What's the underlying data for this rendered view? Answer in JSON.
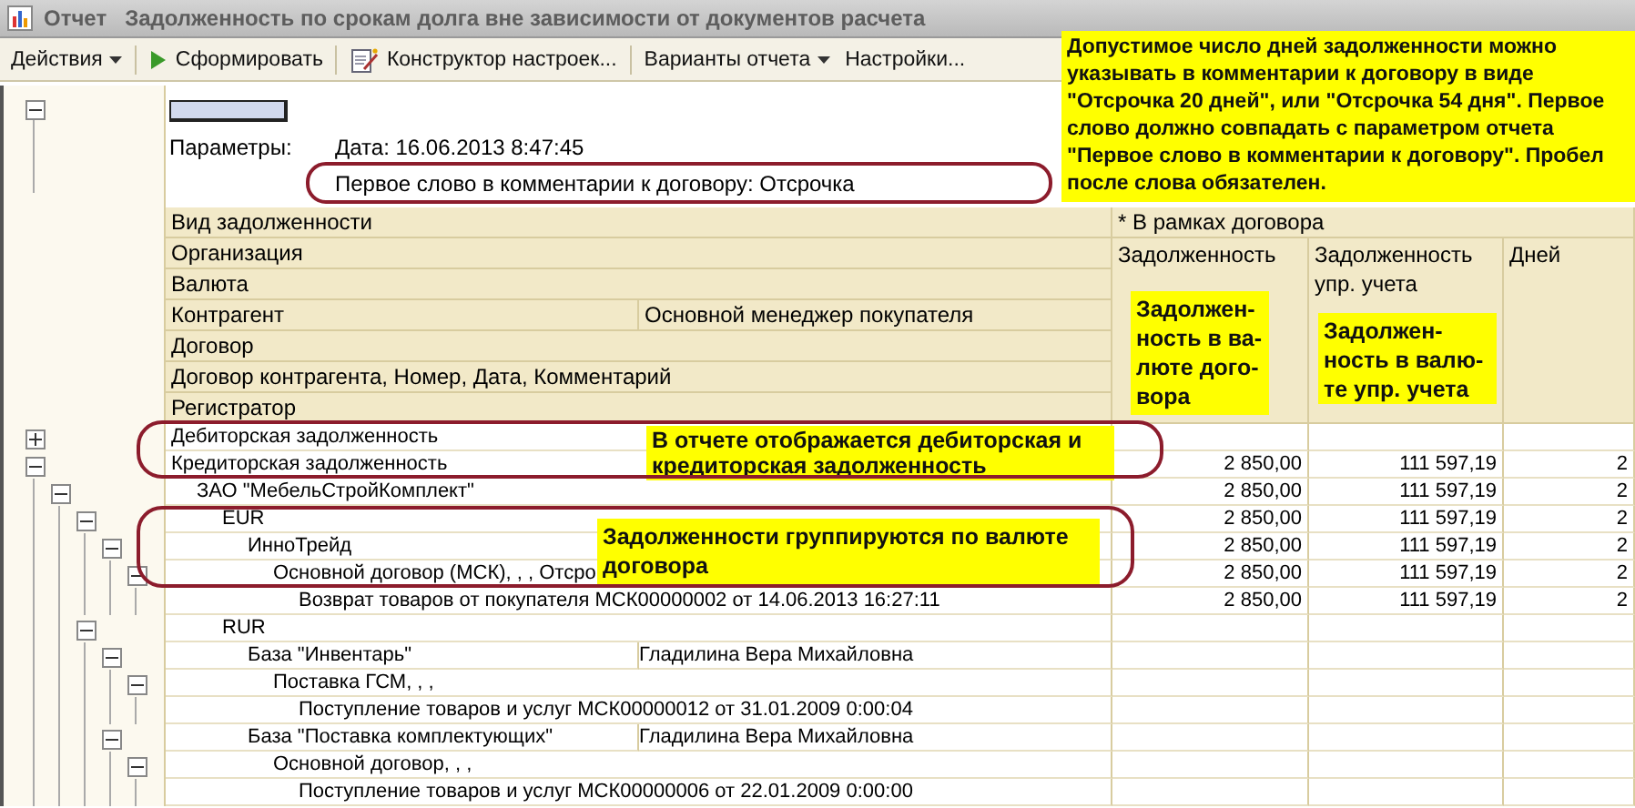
{
  "window": {
    "prefix": "Отчет",
    "title": "Задолженность по срокам долга вне зависимости от документов расчета"
  },
  "toolbar": [
    {
      "label": "Действия",
      "kind": "menu"
    },
    {
      "label": "Сформировать",
      "kind": "run"
    },
    {
      "label": "Конструктор настроек...",
      "kind": "wizard"
    },
    {
      "label": "Варианты отчета",
      "kind": "menu"
    },
    {
      "label": "Настройки...",
      "kind": "plain"
    }
  ],
  "report": {
    "expanded": true,
    "params_label": "Параметры:",
    "params": [
      "Дата: 16.06.2013 8:47:45",
      "Первое слово в комментарии к договору: Отсрочка"
    ]
  },
  "header": {
    "rows": [
      {
        "label": "Вид задолженности"
      },
      {
        "label": "Организация"
      },
      {
        "label": "Валюта"
      },
      {
        "label": "Контрагент",
        "extra": "Основной менеджер покупателя"
      },
      {
        "label": "Договор"
      },
      {
        "label": "Договор контрагента, Номер, Дата, Комментарий"
      },
      {
        "label": "Регистратор"
      }
    ],
    "group": "* В рамках договора",
    "columns": [
      "Задолженность",
      "Задолженность упр. учета",
      "Дней"
    ]
  },
  "rows": [
    {
      "text": "Дебиторская задолженность",
      "expanded": false
    },
    {
      "text": "Кредиторская задолженность",
      "expanded": true,
      "values": [
        "2 850,00",
        "111 597,19",
        "2"
      ],
      "children": [
        {
          "text": "ЗАО \"МебельСтройКомплект\"",
          "expanded": true,
          "values": [
            "2 850,00",
            "111 597,19",
            "2"
          ],
          "children": [
            {
              "text": "EUR",
              "expanded": true,
              "values": [
                "2 850,00",
                "111 597,19",
                "2"
              ],
              "children": [
                {
                  "text": "ИнноТрейд",
                  "expanded": true,
                  "values": [
                    "2 850,00",
                    "111 597,19",
                    "2"
                  ],
                  "children": [
                    {
                      "text": "Основной договор (МСК), , , Отсро",
                      "expanded": true,
                      "values": [
                        "2 850,00",
                        "111 597,19",
                        "2"
                      ],
                      "children": [
                        {
                          "text": "Возврат товаров от покупателя МСК00000002 от 14.06.2013 16:27:11",
                          "values": [
                            "2 850,00",
                            "111 597,19",
                            "2"
                          ]
                        }
                      ]
                    }
                  ]
                }
              ]
            },
            {
              "text": "RUR",
              "expanded": true,
              "children": [
                {
                  "text": "База \"Инвентарь\"",
                  "manager": "Гладилина Вера Михайловна",
                  "expanded": true,
                  "children": [
                    {
                      "text": "Поставка ГСМ, , ,",
                      "expanded": true,
                      "children": [
                        {
                          "text": "Поступление товаров и услуг МСК00000012 от 31.01.2009 0:00:04"
                        }
                      ]
                    }
                  ]
                },
                {
                  "text": "База \"Поставка комплектующих\"",
                  "manager": "Гладилина Вера Михайловна",
                  "expanded": true,
                  "children": [
                    {
                      "text": "Основной договор, , ,",
                      "expanded": true,
                      "children": [
                        {
                          "text": "Поступление товаров и услуг МСК00000006 от 22.01.2009 0:00:00"
                        }
                      ]
                    }
                  ]
                }
              ]
            }
          ]
        }
      ]
    }
  ],
  "notes": {
    "top": "Допустимое число дней задолженности можно указывать в комментарии к договору в виде \"Отсрочка 20 дней\", или \"Отсрочка 54 дня\". Первое слово должно совпадать с параметром отчета \"Первое слово в комментарии к договору\". Пробел после слова обязателен.",
    "currency_column": "Задолжен-ность в ва-люте дого-вора",
    "management_column": "Задолжен-ность в валю-те упр.  учета",
    "rows_kind": "В отчете отображается дебиторская и кредиторская задолженность",
    "rows_grouping": "Задолженности группируются по валюте договора"
  }
}
